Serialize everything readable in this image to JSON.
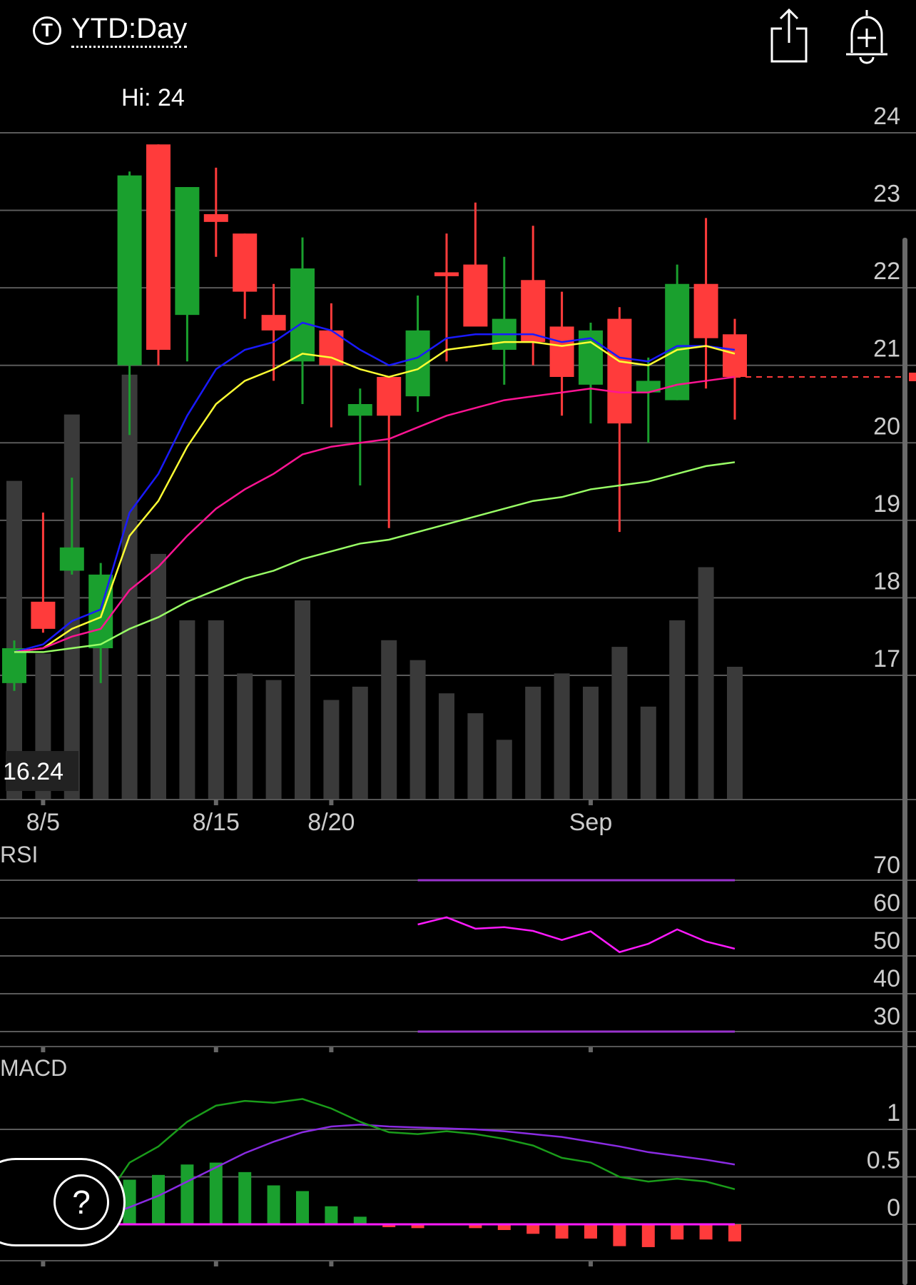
{
  "header": {
    "ticker_icon": "T",
    "range_label": "YTD:Day",
    "share_icon": "share-icon",
    "alert_icon": "add-alert-icon"
  },
  "price_panel": {
    "hi_label": "Hi: 24",
    "lo_label": "16.24",
    "y_ticks": [
      24,
      23,
      22,
      21,
      20,
      19,
      18,
      17
    ]
  },
  "x_labels": [
    "8/5",
    "8/15",
    "8/20",
    "Sep"
  ],
  "rsi_panel": {
    "title": "RSI",
    "ticks": [
      70,
      60,
      50,
      40,
      30
    ]
  },
  "macd_panel": {
    "title": "MACD",
    "ticks": [
      "1",
      "0.5",
      "0"
    ]
  },
  "help": {
    "label": "?"
  },
  "colors": {
    "up": "#1aa02e",
    "down": "#ff3b3b",
    "volume": "#3a3a3a",
    "grid": "#5a5a5a",
    "ma_blue": "#1a1aff",
    "ma_yellow": "#ffff33",
    "ma_magenta": "#ff1493",
    "ma_green": "#99ff66",
    "rsi_line": "#ff1aff",
    "rsi_bands": "#9933cc",
    "macd_line": "#1a9c1a",
    "signal_line": "#8a2be2"
  },
  "chart_data": [
    {
      "type": "candlestick",
      "ylim": [
        16.24,
        24.2
      ],
      "x_tick_labels": [
        "8/5",
        "8/15",
        "8/20",
        "Sep"
      ],
      "candles": [
        {
          "o": 16.9,
          "h": 17.45,
          "l": 16.8,
          "c": 17.35
        },
        {
          "o": 17.95,
          "h": 19.1,
          "l": 17.55,
          "c": 17.6
        },
        {
          "o": 18.35,
          "h": 19.55,
          "l": 18.3,
          "c": 18.65
        },
        {
          "o": 17.35,
          "h": 18.45,
          "l": 16.9,
          "c": 18.3
        },
        {
          "o": 21.0,
          "h": 23.5,
          "l": 20.1,
          "c": 23.45
        },
        {
          "o": 23.85,
          "h": 23.85,
          "l": 21.0,
          "c": 21.2
        },
        {
          "o": 21.65,
          "h": 23.3,
          "l": 21.05,
          "c": 23.3
        },
        {
          "o": 22.95,
          "h": 23.55,
          "l": 22.4,
          "c": 22.85
        },
        {
          "o": 22.7,
          "h": 22.7,
          "l": 21.6,
          "c": 21.95
        },
        {
          "o": 21.65,
          "h": 22.05,
          "l": 20.8,
          "c": 21.45
        },
        {
          "o": 21.05,
          "h": 22.65,
          "l": 20.5,
          "c": 22.25
        },
        {
          "o": 21.45,
          "h": 21.8,
          "l": 20.2,
          "c": 21.0
        },
        {
          "o": 20.35,
          "h": 20.7,
          "l": 19.45,
          "c": 20.5
        },
        {
          "o": 20.85,
          "h": 20.85,
          "l": 18.9,
          "c": 20.35
        },
        {
          "o": 20.6,
          "h": 21.9,
          "l": 20.4,
          "c": 21.45
        },
        {
          "o": 22.2,
          "h": 22.7,
          "l": 21.05,
          "c": 22.15
        },
        {
          "o": 22.3,
          "h": 23.1,
          "l": 21.55,
          "c": 21.5
        },
        {
          "o": 21.2,
          "h": 22.4,
          "l": 20.75,
          "c": 21.6
        },
        {
          "o": 22.1,
          "h": 22.8,
          "l": 21.0,
          "c": 21.3
        },
        {
          "o": 21.5,
          "h": 21.95,
          "l": 20.35,
          "c": 20.85
        },
        {
          "o": 20.75,
          "h": 21.55,
          "l": 20.25,
          "c": 21.45
        },
        {
          "o": 21.6,
          "h": 21.75,
          "l": 18.85,
          "c": 20.25
        },
        {
          "o": 20.65,
          "h": 21.1,
          "l": 20.0,
          "c": 20.8
        },
        {
          "o": 20.55,
          "h": 22.3,
          "l": 20.55,
          "c": 22.05
        },
        {
          "o": 22.05,
          "h": 22.9,
          "l": 20.7,
          "c": 21.35
        },
        {
          "o": 21.4,
          "h": 21.6,
          "l": 20.3,
          "c": 20.85
        }
      ],
      "volume": [
        0.48,
        0.22,
        0.58,
        0.28,
        0.64,
        0.37,
        0.27,
        0.27,
        0.19,
        0.18,
        0.3,
        0.15,
        0.17,
        0.24,
        0.21,
        0.16,
        0.13,
        0.09,
        0.17,
        0.19,
        0.17,
        0.23,
        0.14,
        0.27,
        0.35,
        0.2
      ],
      "last_price": 20.85,
      "series": [
        {
          "color": "blue",
          "values": [
            17.3,
            17.4,
            17.7,
            17.85,
            19.1,
            19.6,
            20.35,
            20.95,
            21.2,
            21.3,
            21.55,
            21.45,
            21.2,
            21.0,
            21.1,
            21.35,
            21.4,
            21.4,
            21.4,
            21.3,
            21.35,
            21.1,
            21.05,
            21.25,
            21.25,
            21.2
          ]
        },
        {
          "color": "yellow",
          "values": [
            17.3,
            17.35,
            17.6,
            17.75,
            18.8,
            19.25,
            19.95,
            20.5,
            20.8,
            20.95,
            21.15,
            21.1,
            20.95,
            20.85,
            20.95,
            21.2,
            21.25,
            21.3,
            21.3,
            21.25,
            21.3,
            21.05,
            21.0,
            21.2,
            21.25,
            21.15
          ]
        },
        {
          "color": "magenta",
          "values": [
            17.3,
            17.35,
            17.5,
            17.6,
            18.1,
            18.4,
            18.8,
            19.15,
            19.4,
            19.6,
            19.85,
            19.95,
            20.0,
            20.05,
            20.2,
            20.35,
            20.45,
            20.55,
            20.6,
            20.65,
            20.7,
            20.65,
            20.65,
            20.75,
            20.8,
            20.85
          ]
        },
        {
          "color": "green",
          "values": [
            17.3,
            17.3,
            17.35,
            17.4,
            17.6,
            17.75,
            17.95,
            18.1,
            18.25,
            18.35,
            18.5,
            18.6,
            18.7,
            18.75,
            18.85,
            18.95,
            19.05,
            19.15,
            19.25,
            19.3,
            19.4,
            19.45,
            19.5,
            19.6,
            19.7,
            19.75
          ]
        }
      ]
    },
    {
      "type": "line",
      "title": "RSI",
      "ylim": [
        27,
        74
      ],
      "bands": [
        70,
        30
      ],
      "start_index": 14,
      "values": [
        58.3,
        60.2,
        57.2,
        57.6,
        56.6,
        54.2,
        56.5,
        51.0,
        53.2,
        57.0,
        53.8,
        51.9
      ]
    },
    {
      "type": "bar",
      "title": "MACD",
      "ylim": [
        -0.45,
        1.3
      ],
      "macd": [
        0.0,
        0.05,
        0.13,
        0.2,
        0.65,
        0.82,
        1.08,
        1.25,
        1.3,
        1.28,
        1.32,
        1.22,
        1.08,
        0.97,
        0.95,
        0.98,
        0.95,
        0.9,
        0.83,
        0.7,
        0.65,
        0.5,
        0.45,
        0.48,
        0.45,
        0.37
      ],
      "signal": [
        0.0,
        0.0,
        0.02,
        0.07,
        0.18,
        0.3,
        0.45,
        0.6,
        0.75,
        0.87,
        0.97,
        1.03,
        1.05,
        1.03,
        1.02,
        1.01,
        1.0,
        0.98,
        0.95,
        0.92,
        0.87,
        0.82,
        0.76,
        0.72,
        0.68,
        0.63
      ],
      "histogram": [
        0.0,
        0.05,
        0.11,
        0.13,
        0.47,
        0.52,
        0.63,
        0.65,
        0.55,
        0.41,
        0.35,
        0.19,
        0.08,
        -0.03,
        -0.04,
        -0.01,
        -0.04,
        -0.06,
        -0.1,
        -0.15,
        -0.15,
        -0.23,
        -0.24,
        -0.16,
        -0.16,
        -0.18
      ]
    }
  ]
}
